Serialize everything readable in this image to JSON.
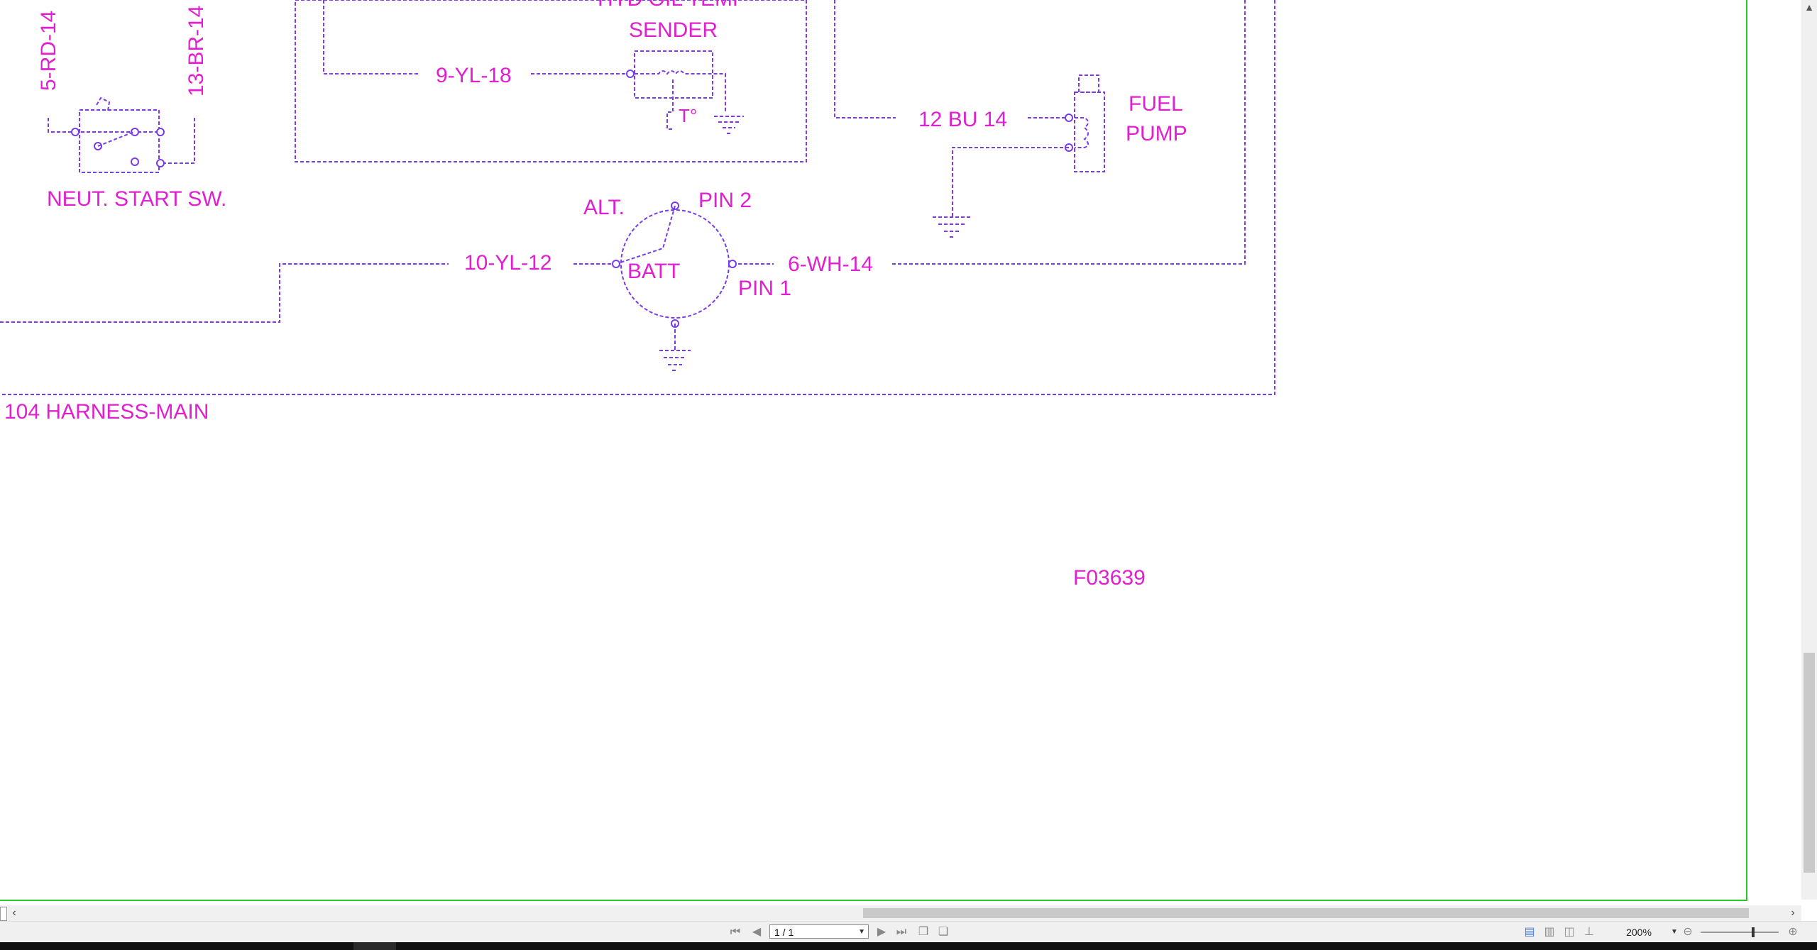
{
  "colors": {
    "label": "#e020d0",
    "wire": "#7a3be8",
    "page_border": "#22cc22",
    "chrome_bg": "#f0f0f0"
  },
  "schematic": {
    "wire_5": "5-RD-14",
    "wire_13": "13-BR-14",
    "neutral_start_switch": "NEUT. START SW.",
    "hyd_oil_temp_line1": "HYD OIL TEMP",
    "hyd_oil_temp_line2": "SENDER",
    "temp_symbol": "T°",
    "wire_9": "9-YL-18",
    "wire_12": "12 BU 14",
    "fuel_pump_line1": "FUEL",
    "fuel_pump_line2": "PUMP",
    "alt_label": "ALT.",
    "pin2": "PIN 2",
    "batt": "BATT",
    "pin1": "PIN 1",
    "wire_10": "10-YL-12",
    "wire_6": "6-WH-14",
    "harness": "104 HARNESS-MAIN",
    "figure_id": "F03639"
  },
  "statusbar": {
    "page_indicator": "1 / 1",
    "zoom": "200%",
    "icons": {
      "first": "first-page-icon",
      "prev": "previous-page-icon",
      "next": "next-page-icon",
      "last": "last-page-icon"
    }
  }
}
